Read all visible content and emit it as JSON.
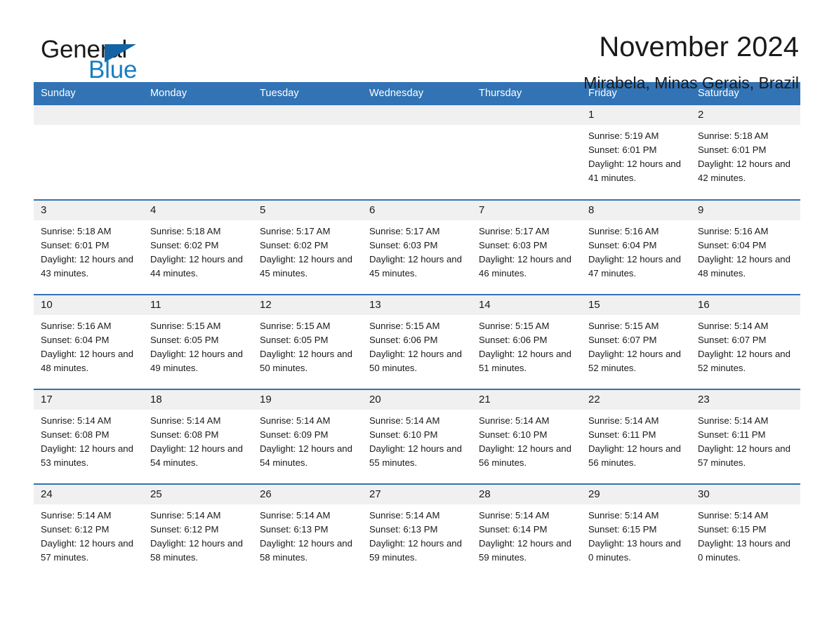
{
  "brand": {
    "name_part1": "General",
    "name_part2": "Blue",
    "triangle_color": "#1464a5",
    "blue_text_color": "#1a7fc1"
  },
  "header": {
    "title": "November 2024",
    "location": "Mirabela, Minas Gerais, Brazil"
  },
  "theme": {
    "header_bg": "#3273b5",
    "daynum_bg": "#f0f0f0",
    "row_border": "#3273b5",
    "text": "#1a1a1a"
  },
  "weekday_headers": [
    "Sunday",
    "Monday",
    "Tuesday",
    "Wednesday",
    "Thursday",
    "Friday",
    "Saturday"
  ],
  "weeks": [
    [
      {
        "day": "",
        "empty": true
      },
      {
        "day": "",
        "empty": true
      },
      {
        "day": "",
        "empty": true
      },
      {
        "day": "",
        "empty": true
      },
      {
        "day": "",
        "empty": true
      },
      {
        "day": "1",
        "sunrise": "Sunrise: 5:19 AM",
        "sunset": "Sunset: 6:01 PM",
        "daylight": "Daylight: 12 hours and 41 minutes."
      },
      {
        "day": "2",
        "sunrise": "Sunrise: 5:18 AM",
        "sunset": "Sunset: 6:01 PM",
        "daylight": "Daylight: 12 hours and 42 minutes."
      }
    ],
    [
      {
        "day": "3",
        "sunrise": "Sunrise: 5:18 AM",
        "sunset": "Sunset: 6:01 PM",
        "daylight": "Daylight: 12 hours and 43 minutes."
      },
      {
        "day": "4",
        "sunrise": "Sunrise: 5:18 AM",
        "sunset": "Sunset: 6:02 PM",
        "daylight": "Daylight: 12 hours and 44 minutes."
      },
      {
        "day": "5",
        "sunrise": "Sunrise: 5:17 AM",
        "sunset": "Sunset: 6:02 PM",
        "daylight": "Daylight: 12 hours and 45 minutes."
      },
      {
        "day": "6",
        "sunrise": "Sunrise: 5:17 AM",
        "sunset": "Sunset: 6:03 PM",
        "daylight": "Daylight: 12 hours and 45 minutes."
      },
      {
        "day": "7",
        "sunrise": "Sunrise: 5:17 AM",
        "sunset": "Sunset: 6:03 PM",
        "daylight": "Daylight: 12 hours and 46 minutes."
      },
      {
        "day": "8",
        "sunrise": "Sunrise: 5:16 AM",
        "sunset": "Sunset: 6:04 PM",
        "daylight": "Daylight: 12 hours and 47 minutes."
      },
      {
        "day": "9",
        "sunrise": "Sunrise: 5:16 AM",
        "sunset": "Sunset: 6:04 PM",
        "daylight": "Daylight: 12 hours and 48 minutes."
      }
    ],
    [
      {
        "day": "10",
        "sunrise": "Sunrise: 5:16 AM",
        "sunset": "Sunset: 6:04 PM",
        "daylight": "Daylight: 12 hours and 48 minutes."
      },
      {
        "day": "11",
        "sunrise": "Sunrise: 5:15 AM",
        "sunset": "Sunset: 6:05 PM",
        "daylight": "Daylight: 12 hours and 49 minutes."
      },
      {
        "day": "12",
        "sunrise": "Sunrise: 5:15 AM",
        "sunset": "Sunset: 6:05 PM",
        "daylight": "Daylight: 12 hours and 50 minutes."
      },
      {
        "day": "13",
        "sunrise": "Sunrise: 5:15 AM",
        "sunset": "Sunset: 6:06 PM",
        "daylight": "Daylight: 12 hours and 50 minutes."
      },
      {
        "day": "14",
        "sunrise": "Sunrise: 5:15 AM",
        "sunset": "Sunset: 6:06 PM",
        "daylight": "Daylight: 12 hours and 51 minutes."
      },
      {
        "day": "15",
        "sunrise": "Sunrise: 5:15 AM",
        "sunset": "Sunset: 6:07 PM",
        "daylight": "Daylight: 12 hours and 52 minutes."
      },
      {
        "day": "16",
        "sunrise": "Sunrise: 5:14 AM",
        "sunset": "Sunset: 6:07 PM",
        "daylight": "Daylight: 12 hours and 52 minutes."
      }
    ],
    [
      {
        "day": "17",
        "sunrise": "Sunrise: 5:14 AM",
        "sunset": "Sunset: 6:08 PM",
        "daylight": "Daylight: 12 hours and 53 minutes."
      },
      {
        "day": "18",
        "sunrise": "Sunrise: 5:14 AM",
        "sunset": "Sunset: 6:08 PM",
        "daylight": "Daylight: 12 hours and 54 minutes."
      },
      {
        "day": "19",
        "sunrise": "Sunrise: 5:14 AM",
        "sunset": "Sunset: 6:09 PM",
        "daylight": "Daylight: 12 hours and 54 minutes."
      },
      {
        "day": "20",
        "sunrise": "Sunrise: 5:14 AM",
        "sunset": "Sunset: 6:10 PM",
        "daylight": "Daylight: 12 hours and 55 minutes."
      },
      {
        "day": "21",
        "sunrise": "Sunrise: 5:14 AM",
        "sunset": "Sunset: 6:10 PM",
        "daylight": "Daylight: 12 hours and 56 minutes."
      },
      {
        "day": "22",
        "sunrise": "Sunrise: 5:14 AM",
        "sunset": "Sunset: 6:11 PM",
        "daylight": "Daylight: 12 hours and 56 minutes."
      },
      {
        "day": "23",
        "sunrise": "Sunrise: 5:14 AM",
        "sunset": "Sunset: 6:11 PM",
        "daylight": "Daylight: 12 hours and 57 minutes."
      }
    ],
    [
      {
        "day": "24",
        "sunrise": "Sunrise: 5:14 AM",
        "sunset": "Sunset: 6:12 PM",
        "daylight": "Daylight: 12 hours and 57 minutes."
      },
      {
        "day": "25",
        "sunrise": "Sunrise: 5:14 AM",
        "sunset": "Sunset: 6:12 PM",
        "daylight": "Daylight: 12 hours and 58 minutes."
      },
      {
        "day": "26",
        "sunrise": "Sunrise: 5:14 AM",
        "sunset": "Sunset: 6:13 PM",
        "daylight": "Daylight: 12 hours and 58 minutes."
      },
      {
        "day": "27",
        "sunrise": "Sunrise: 5:14 AM",
        "sunset": "Sunset: 6:13 PM",
        "daylight": "Daylight: 12 hours and 59 minutes."
      },
      {
        "day": "28",
        "sunrise": "Sunrise: 5:14 AM",
        "sunset": "Sunset: 6:14 PM",
        "daylight": "Daylight: 12 hours and 59 minutes."
      },
      {
        "day": "29",
        "sunrise": "Sunrise: 5:14 AM",
        "sunset": "Sunset: 6:15 PM",
        "daylight": "Daylight: 13 hours and 0 minutes."
      },
      {
        "day": "30",
        "sunrise": "Sunrise: 5:14 AM",
        "sunset": "Sunset: 6:15 PM",
        "daylight": "Daylight: 13 hours and 0 minutes."
      }
    ]
  ]
}
